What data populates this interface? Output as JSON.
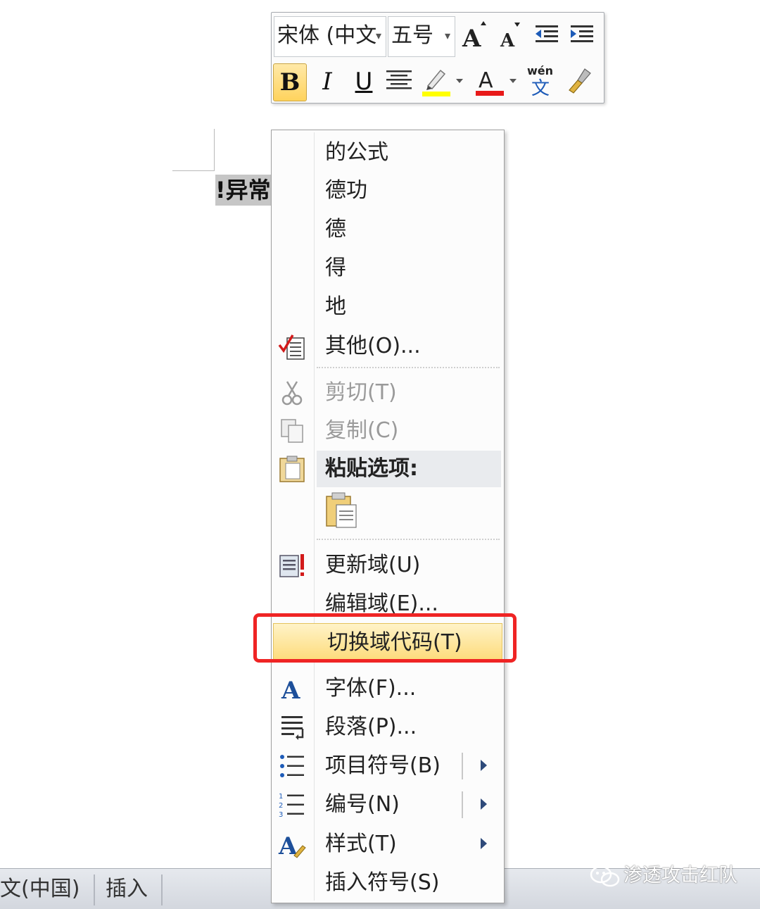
{
  "document": {
    "selected_text": "!异常"
  },
  "mini_toolbar": {
    "font_name": "宋体 (中文",
    "font_size": "五号",
    "bold": "B",
    "italic": "I",
    "underline": "U"
  },
  "context_menu": {
    "suggestions": [
      "的公式",
      "德功",
      "德",
      "得",
      "地"
    ],
    "other": "其他(O)...",
    "cut": "剪切(T)",
    "copy": "复制(C)",
    "paste_options": "粘贴选项:",
    "update_field": "更新域(U)",
    "edit_field": "编辑域(E)...",
    "toggle_field_codes": "切换域代码(T)",
    "font": "字体(F)...",
    "paragraph": "段落(P)...",
    "bullets": "项目符号(B)",
    "numbering": "编号(N)",
    "styles": "样式(T)",
    "insert_symbol": "插入符号(S)"
  },
  "status_bar": {
    "language": "文(中国)",
    "insert_mode": "插入"
  },
  "watermark": "渗透攻击红队",
  "colors": {
    "highlight_fill": "#fddb7a",
    "annotation_red": "#ef2424",
    "font_color_bar": "#e81919",
    "highlighter_bar": "#ffff00"
  }
}
